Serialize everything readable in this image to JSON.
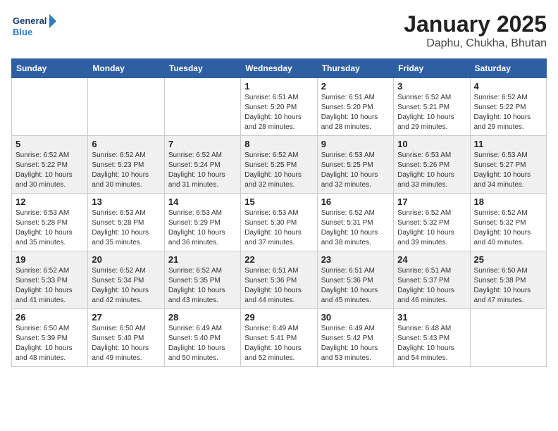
{
  "header": {
    "logo_text_1": "General",
    "logo_text_2": "Blue",
    "title": "January 2025",
    "subtitle": "Daphu, Chukha, Bhutan"
  },
  "days_of_week": [
    "Sunday",
    "Monday",
    "Tuesday",
    "Wednesday",
    "Thursday",
    "Friday",
    "Saturday"
  ],
  "weeks": [
    {
      "cells": [
        {
          "day": "",
          "info": ""
        },
        {
          "day": "",
          "info": ""
        },
        {
          "day": "",
          "info": ""
        },
        {
          "day": "1",
          "info": "Sunrise: 6:51 AM\nSunset: 5:20 PM\nDaylight: 10 hours\nand 28 minutes."
        },
        {
          "day": "2",
          "info": "Sunrise: 6:51 AM\nSunset: 5:20 PM\nDaylight: 10 hours\nand 28 minutes."
        },
        {
          "day": "3",
          "info": "Sunrise: 6:52 AM\nSunset: 5:21 PM\nDaylight: 10 hours\nand 29 minutes."
        },
        {
          "day": "4",
          "info": "Sunrise: 6:52 AM\nSunset: 5:22 PM\nDaylight: 10 hours\nand 29 minutes."
        }
      ]
    },
    {
      "cells": [
        {
          "day": "5",
          "info": "Sunrise: 6:52 AM\nSunset: 5:22 PM\nDaylight: 10 hours\nand 30 minutes."
        },
        {
          "day": "6",
          "info": "Sunrise: 6:52 AM\nSunset: 5:23 PM\nDaylight: 10 hours\nand 30 minutes."
        },
        {
          "day": "7",
          "info": "Sunrise: 6:52 AM\nSunset: 5:24 PM\nDaylight: 10 hours\nand 31 minutes."
        },
        {
          "day": "8",
          "info": "Sunrise: 6:52 AM\nSunset: 5:25 PM\nDaylight: 10 hours\nand 32 minutes."
        },
        {
          "day": "9",
          "info": "Sunrise: 6:53 AM\nSunset: 5:25 PM\nDaylight: 10 hours\nand 32 minutes."
        },
        {
          "day": "10",
          "info": "Sunrise: 6:53 AM\nSunset: 5:26 PM\nDaylight: 10 hours\nand 33 minutes."
        },
        {
          "day": "11",
          "info": "Sunrise: 6:53 AM\nSunset: 5:27 PM\nDaylight: 10 hours\nand 34 minutes."
        }
      ]
    },
    {
      "cells": [
        {
          "day": "12",
          "info": "Sunrise: 6:53 AM\nSunset: 5:28 PM\nDaylight: 10 hours\nand 35 minutes."
        },
        {
          "day": "13",
          "info": "Sunrise: 6:53 AM\nSunset: 5:28 PM\nDaylight: 10 hours\nand 35 minutes."
        },
        {
          "day": "14",
          "info": "Sunrise: 6:53 AM\nSunset: 5:29 PM\nDaylight: 10 hours\nand 36 minutes."
        },
        {
          "day": "15",
          "info": "Sunrise: 6:53 AM\nSunset: 5:30 PM\nDaylight: 10 hours\nand 37 minutes."
        },
        {
          "day": "16",
          "info": "Sunrise: 6:52 AM\nSunset: 5:31 PM\nDaylight: 10 hours\nand 38 minutes."
        },
        {
          "day": "17",
          "info": "Sunrise: 6:52 AM\nSunset: 5:32 PM\nDaylight: 10 hours\nand 39 minutes."
        },
        {
          "day": "18",
          "info": "Sunrise: 6:52 AM\nSunset: 5:32 PM\nDaylight: 10 hours\nand 40 minutes."
        }
      ]
    },
    {
      "cells": [
        {
          "day": "19",
          "info": "Sunrise: 6:52 AM\nSunset: 5:33 PM\nDaylight: 10 hours\nand 41 minutes."
        },
        {
          "day": "20",
          "info": "Sunrise: 6:52 AM\nSunset: 5:34 PM\nDaylight: 10 hours\nand 42 minutes."
        },
        {
          "day": "21",
          "info": "Sunrise: 6:52 AM\nSunset: 5:35 PM\nDaylight: 10 hours\nand 43 minutes."
        },
        {
          "day": "22",
          "info": "Sunrise: 6:51 AM\nSunset: 5:36 PM\nDaylight: 10 hours\nand 44 minutes."
        },
        {
          "day": "23",
          "info": "Sunrise: 6:51 AM\nSunset: 5:36 PM\nDaylight: 10 hours\nand 45 minutes."
        },
        {
          "day": "24",
          "info": "Sunrise: 6:51 AM\nSunset: 5:37 PM\nDaylight: 10 hours\nand 46 minutes."
        },
        {
          "day": "25",
          "info": "Sunrise: 6:50 AM\nSunset: 5:38 PM\nDaylight: 10 hours\nand 47 minutes."
        }
      ]
    },
    {
      "cells": [
        {
          "day": "26",
          "info": "Sunrise: 6:50 AM\nSunset: 5:39 PM\nDaylight: 10 hours\nand 48 minutes."
        },
        {
          "day": "27",
          "info": "Sunrise: 6:50 AM\nSunset: 5:40 PM\nDaylight: 10 hours\nand 49 minutes."
        },
        {
          "day": "28",
          "info": "Sunrise: 6:49 AM\nSunset: 5:40 PM\nDaylight: 10 hours\nand 50 minutes."
        },
        {
          "day": "29",
          "info": "Sunrise: 6:49 AM\nSunset: 5:41 PM\nDaylight: 10 hours\nand 52 minutes."
        },
        {
          "day": "30",
          "info": "Sunrise: 6:49 AM\nSunset: 5:42 PM\nDaylight: 10 hours\nand 53 minutes."
        },
        {
          "day": "31",
          "info": "Sunrise: 6:48 AM\nSunset: 5:43 PM\nDaylight: 10 hours\nand 54 minutes."
        },
        {
          "day": "",
          "info": ""
        }
      ]
    }
  ]
}
